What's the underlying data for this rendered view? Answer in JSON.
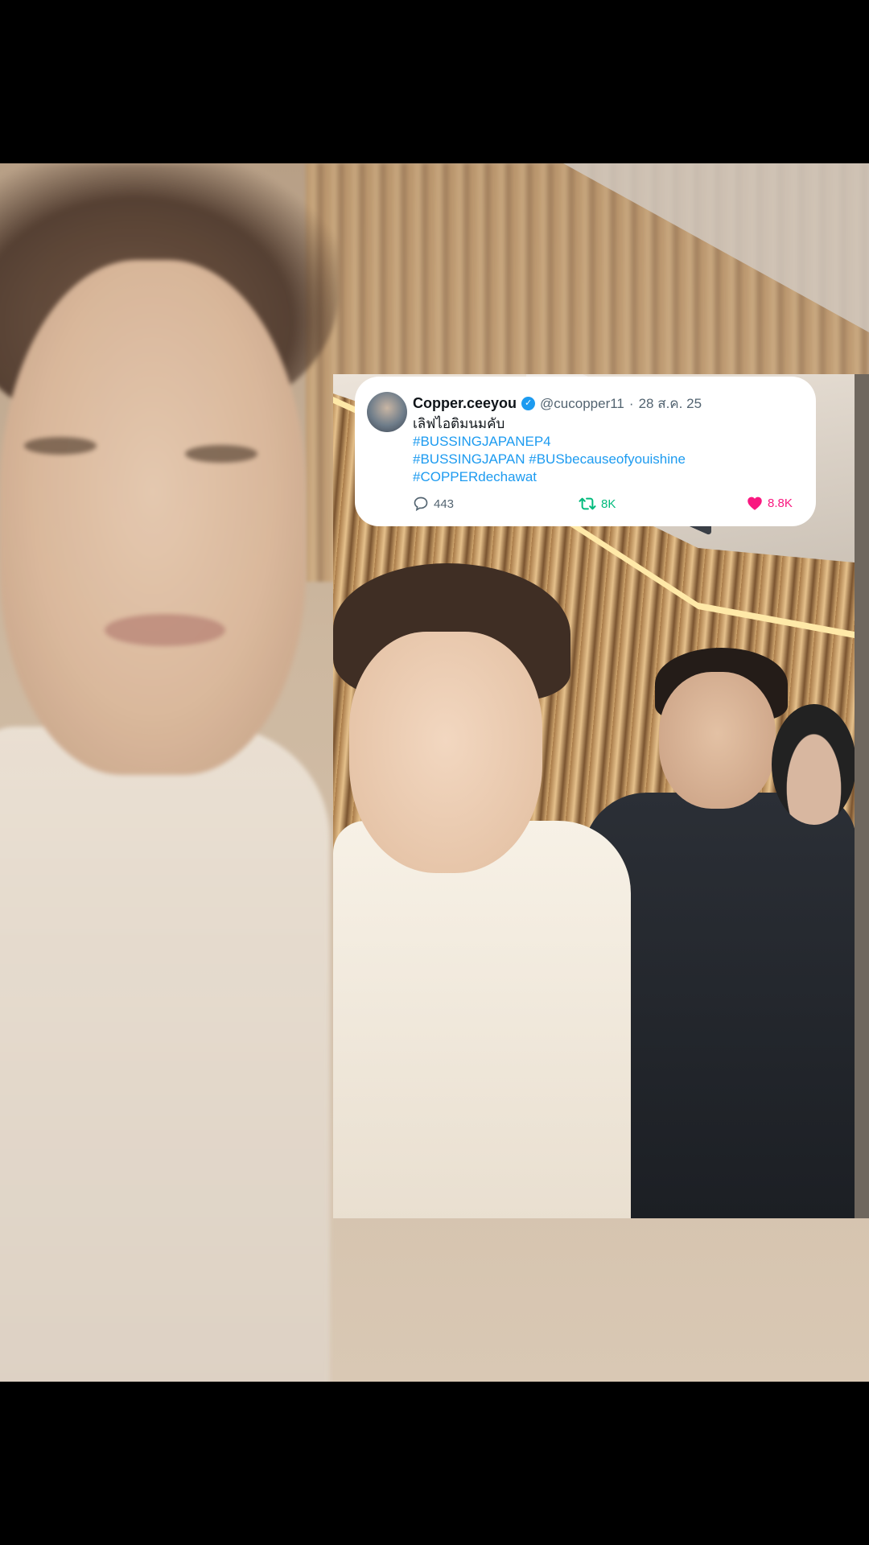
{
  "tweet": {
    "display_name": "Copper.ceeyou",
    "handle": "@cucopper11",
    "separator": "·",
    "date": "28 ส.ค. 25",
    "text": "เลิฟไอติมนมคับ",
    "hashtags": [
      "#BUSSINGJAPANEP4",
      "#BUSSINGJAPAN",
      "#BUSbecauseofyouishine",
      "#COPPERdechawat"
    ],
    "replies": "443",
    "retweets": "8K",
    "likes": "8.8K"
  },
  "icons": {
    "verified": "verified-badge-icon",
    "reply": "reply-icon",
    "retweet": "retweet-icon",
    "like": "heart-icon"
  },
  "colors": {
    "link": "#1d9bf0",
    "retweet": "#00ba7c",
    "like": "#f91880",
    "muted": "#536471"
  }
}
